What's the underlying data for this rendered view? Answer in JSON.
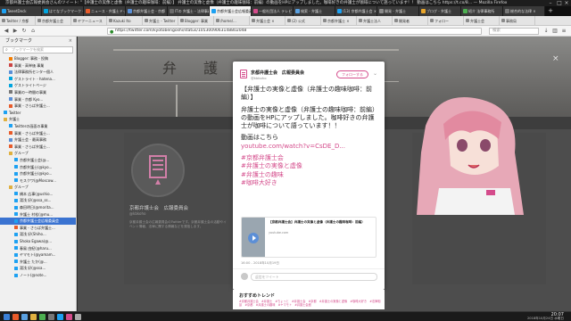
{
  "window": {
    "title": "京都弁護士会広報委員会さんのツイート: \"【弁護士の実像と虚像（弁護士の趣味咖啡：前編）】 弁護士の実像と虚像（弁護士の趣味咖啡：前編）の動画をHPにアップしました。咖啡好きの弁護士が咖啡について語っています！！ 動画はこちら https://t.co/8… — Mozilla Firefox"
  },
  "tabs": [
    {
      "label": "TweetDeck",
      "color": "#1da1f2"
    },
    {
      "label": "はてなブックマーク - hatena",
      "color": "#00a4de"
    },
    {
      "label": "ニュース - 弁護士ドットコム",
      "color": "#e85b2a"
    },
    {
      "label": "京都弁護士会 - 京都",
      "color": "#5a8fd6"
    },
    {
      "label": "ITの 弁護士・法律事務所",
      "color": "#6a6a6a"
    },
    {
      "label": "京都弁護士会広報委員会",
      "color": "#1da1f2",
      "active": true
    },
    {
      "label": "一般社団法人 テレビ",
      "color": "#d44b8b"
    },
    {
      "label": "検索 - 弁護士",
      "color": "#5aa0e0"
    },
    {
      "label": "(13) 京都弁護士会 ×",
      "color": "#1da1f2"
    },
    {
      "label": "開発 - 弁護士",
      "color": "#8a8a8a"
    },
    {
      "label": "ブログ - 弁護士",
      "color": "#e8a52a"
    },
    {
      "label": "紹介 法律事務所",
      "color": "#4caf50"
    },
    {
      "label": "総合的な法律 ×",
      "color": "#777777"
    }
  ],
  "tabs2": [
    "Twitter / 京都",
    "京都弁護士会",
    "ヤフーニュース",
    "Kazuki Ito",
    "弁護士 - Twitter",
    "Blogger: 事業",
    "/home/...",
    "弁護士会 ×",
    "(2) 公式",
    "京都弁護士 ×",
    "弁護士法人",
    "開発者",
    "フォロー",
    "弁護士会",
    "事務局"
  ],
  "navbar": {
    "url": "https://twitter.com/kyotobengoshi/status/1053009063148802048",
    "search_placeholder": "検索"
  },
  "sidebar": {
    "header": "ブックマーク",
    "search_placeholder": "ブックマークを検索",
    "items": [
      {
        "label": "Blogger: 事務 - 投稿",
        "color": "#f57d00",
        "indent": 1
      },
      {
        "label": "事業 - 高単価 事業",
        "color": "#c44",
        "indent": 1
      },
      {
        "label": "法律事務所センター個人",
        "color": "#5a8fd6",
        "indent": 1
      },
      {
        "label": "ゲストライト - hatena...",
        "color": "#00a4de",
        "indent": 1
      },
      {
        "label": "ゲストライトページ",
        "color": "#00a4de",
        "indent": 1
      },
      {
        "label": "事業の一時間の事業",
        "color": "#777",
        "indent": 1
      },
      {
        "label": "事業 - 京都 Kyo...",
        "color": "#5a8fd6",
        "indent": 1
      },
      {
        "label": "事業 - さらば弁護士...",
        "color": "#e85b2a",
        "indent": 1
      },
      {
        "label": "Twitter",
        "color": "#1da1f2",
        "indent": 0,
        "folder": true
      },
      {
        "label": "弁護士",
        "color": "#e0b040",
        "indent": 0,
        "folder": true
      },
      {
        "label": "Twitterの画面の事業",
        "color": "#1da1f2",
        "indent": 1
      },
      {
        "label": "事業 - さらば弁護士...",
        "color": "#e85b2a",
        "indent": 1
      },
      {
        "label": "弁護士会 - 最高事務",
        "color": "#5a8fd6",
        "indent": 1
      },
      {
        "label": "事業 - さらば弁護士...",
        "color": "#e85b2a",
        "indent": 1
      },
      {
        "label": "グループ",
        "color": "#e0b040",
        "indent": 1,
        "folder": true
      },
      {
        "label": "京都弁護士会(@...",
        "color": "#1da1f2",
        "indent": 2
      },
      {
        "label": "京都弁護士(@kyo...",
        "color": "#1da1f2",
        "indent": 2
      },
      {
        "label": "京都弁護士(@kyo...",
        "color": "#1da1f2",
        "indent": 2
      },
      {
        "label": "モスクワ(@Moscow...",
        "color": "#1da1f2",
        "indent": 2
      },
      {
        "label": "グループ",
        "color": "#e0b040",
        "indent": 1,
        "folder": true
      },
      {
        "label": "橋本 広事(@ushio...",
        "color": "#1da1f2",
        "indent": 2
      },
      {
        "label": "湯浅 好(@ssa_ss...",
        "color": "#1da1f2",
        "indent": 2
      },
      {
        "label": "森田明日(@morita...",
        "color": "#1da1f2",
        "indent": 2
      },
      {
        "label": "弁護士 村松(@mu...",
        "color": "#1da1f2",
        "indent": 2
      },
      {
        "label": "京都弁護士会広報委員会",
        "color": "#1da1f2",
        "indent": 2,
        "selected": true
      },
      {
        "label": "事業 - さらば弁護士...",
        "color": "#e85b2a",
        "indent": 2
      },
      {
        "label": "湯浅 好(Shiho...",
        "color": "#1da1f2",
        "indent": 2
      },
      {
        "label": "Shoko Egawa(@...",
        "color": "#1da1f2",
        "indent": 2
      },
      {
        "label": "春風 由紀(@haru...",
        "color": "#1da1f2",
        "indent": 2
      },
      {
        "label": "ヤマモト(@yamam...",
        "color": "#1da1f2",
        "indent": 2
      },
      {
        "label": "弁護士 たか(@...",
        "color": "#1da1f2",
        "indent": 2
      },
      {
        "label": "湯浅 好(@ssa...",
        "color": "#1da1f2",
        "indent": 2
      },
      {
        "label": "ノート(@note...",
        "color": "#1da1f2",
        "indent": 2
      }
    ]
  },
  "profile": {
    "name": "京都弁護士会　広報委員会",
    "handle": "@kbkoho",
    "bio": "京都弁護士会の広報委員会のTwitterです。京都弁護士会の活動やイベント情報、法律に関する情報などを発信します。"
  },
  "banner": {
    "sign": "弁護"
  },
  "tweet": {
    "account_name": "京都弁護士会　広報委員会",
    "account_handle": "@kbkoho",
    "follow_label": "フォローする",
    "heading": "【弁護士の実像と虚像（弁護士の趣味咖啡：前編）】",
    "body": "弁護士の実像と虚像（弁護士の趣味咖啡：前編）の動画をHPにアップしました。咖啡好きの弁護士が咖啡について語っています！！",
    "video_lead": "動画はこちら",
    "video_link": "youtube.com/watch?v=CsDE_D...",
    "hashtags": [
      "#京都弁護士会",
      "#弁護士の実像と虚像",
      "#弁護士の趣味",
      "#咖啡大好き"
    ],
    "card_title": "【京都弁護士会】弁護士の実像と虚像（弁護士の趣味咖啡：前編）",
    "card_domain": "youtube.com",
    "time": "16:00 - 2018年10月19日",
    "reply_placeholder": "返信をツイート"
  },
  "trends": {
    "title": "おすすめトレンド",
    "text": "#京都弁護士会　#弁護士　#ちょっと　#弁護士会　#京都　#弁護士の実像と虚像　#咖啡大好き　#法律相談　#京都　#弁護士の趣味　#ヤマモト　#弁護士会館"
  },
  "taskbar": {
    "clock": "20:07",
    "date": "2018年10月24日 水曜日",
    "icons": [
      "#3a7fd6",
      "#e85b2a",
      "#5aa0e0",
      "#e0b040",
      "#4caf50",
      "#777777",
      "#1da1f2",
      "#d44b8b",
      "#aaaaaa"
    ]
  },
  "colors": {
    "accent": "#d44b8b",
    "selection": "#3a73d1"
  }
}
